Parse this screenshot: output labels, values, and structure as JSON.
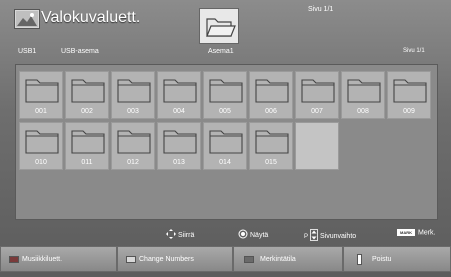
{
  "header": {
    "title": "Valokuvaluett.",
    "page_info": "Sivu 1/1",
    "usb_label": "USB1",
    "usb_name": "USB-asema",
    "current_folder": "Asema1",
    "page_right": "Sivu 1/1",
    "app_icon": "photo-icon",
    "folder_icon": "folder-open-icon"
  },
  "folders": [
    {
      "label": "001"
    },
    {
      "label": "002"
    },
    {
      "label": "003"
    },
    {
      "label": "004"
    },
    {
      "label": "005"
    },
    {
      "label": "006"
    },
    {
      "label": "007"
    },
    {
      "label": "008"
    },
    {
      "label": "009"
    },
    {
      "label": "010"
    },
    {
      "label": "011"
    },
    {
      "label": "012"
    },
    {
      "label": "013"
    },
    {
      "label": "014"
    },
    {
      "label": "015"
    }
  ],
  "hints": {
    "move": "Siirrä",
    "view": "Näytä",
    "page_prefix": "P",
    "page_change": "Sivunvaihto",
    "mark_key": "MARK",
    "mark": "Merk."
  },
  "bottom_bar": {
    "red": "Musiikkiluett.",
    "green": "Change Numbers",
    "yellow": "Merkintätila",
    "exit": "Poistu"
  },
  "colors": {
    "background": "#6e6e6e",
    "tile": "#b3b3b3",
    "text": "#ffffff",
    "swatch_red": "#7a3a3a",
    "swatch_green": "#d8d8d8",
    "swatch_yellow": "#6a6a6a"
  }
}
